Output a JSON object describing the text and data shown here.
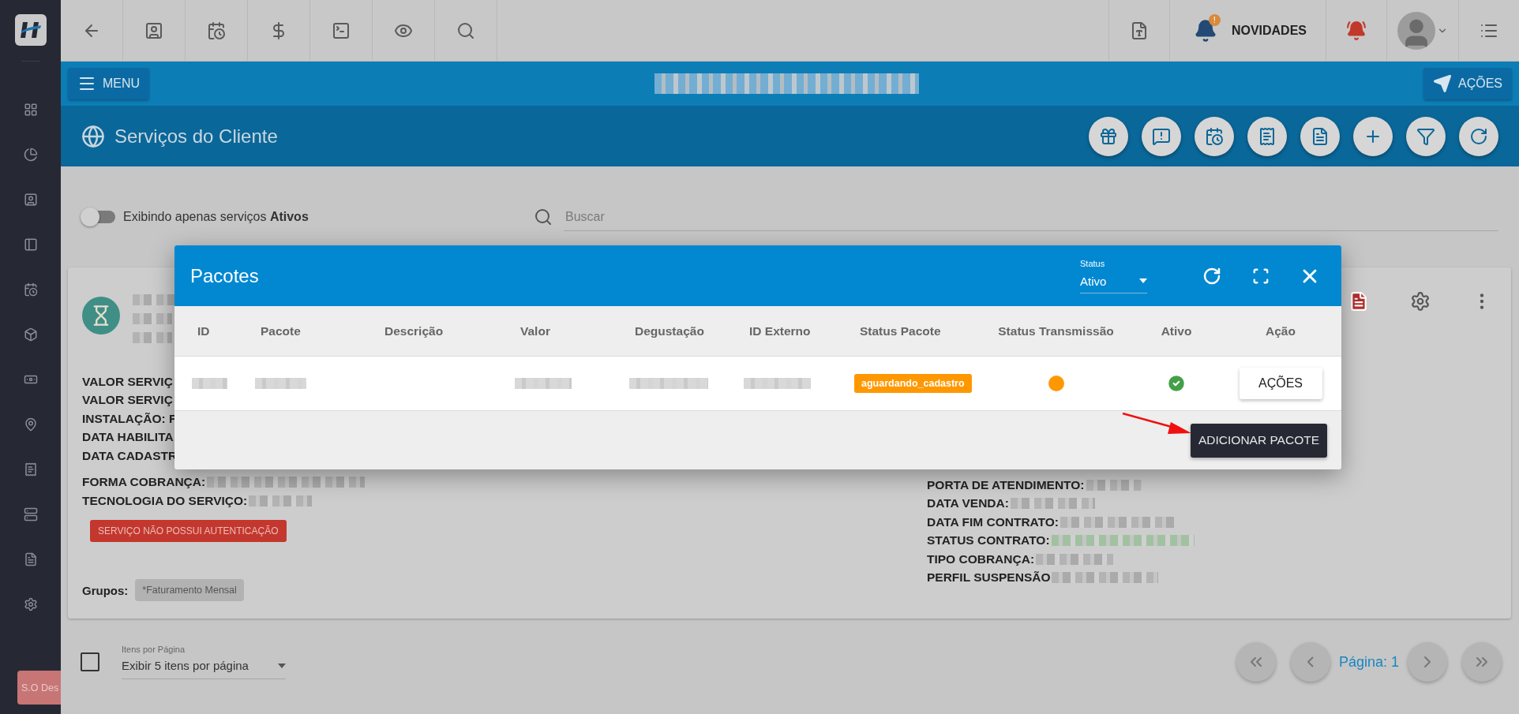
{
  "sidebar": {
    "bottom_button": "S.O Des"
  },
  "toolbar": {
    "news": "NOVIDADES",
    "news_badge": "!"
  },
  "header": {
    "menu": "MENU",
    "actions": "AÇÕES"
  },
  "title_bar": {
    "title": "Serviços do Cliente"
  },
  "filter": {
    "toggle_on": false,
    "toggle_label": "Exibindo apenas serviços **Ativos**",
    "search_placeholder": "Buscar"
  },
  "card": {
    "left_fields": [
      "VALOR SERVIÇ",
      "VALOR SERVIÇ",
      "INSTALAÇÃO: F",
      "DATA HABILITA",
      "DATA CADASTR",
      "FORMA COBRANÇA:",
      "TECNOLOGIA DO SERVIÇO:"
    ],
    "auth_badge": "SERVIÇO NÃO POSSUI AUTENTICAÇÃO",
    "groups_label": "Grupos:",
    "groups": [
      "*Faturamento Mensal"
    ],
    "right_fields": [
      "PORTA DE ATENDIMENTO:",
      "DATA VENDA:",
      "DATA FIM CONTRATO:",
      "STATUS CONTRATO:",
      "TIPO COBRANÇA:",
      "PERFIL SUSPENSÃO"
    ]
  },
  "pagination": {
    "per_page_label": "Itens por Página",
    "per_page_value": "Exibir 5 itens por página",
    "select_all": false,
    "page": "Página: 1"
  },
  "modal": {
    "title": "Pacotes",
    "status_label": "Status",
    "status_value": "Ativo",
    "columns": [
      "ID",
      "Pacote",
      "Descrição",
      "Valor",
      "Degustação",
      "ID Externo",
      "Status Pacote",
      "Status Transmissão",
      "Ativo",
      "Ação"
    ],
    "rows": [
      {
        "status": "aguardando_cadastro",
        "active": true,
        "action": "AÇÕES"
      }
    ],
    "add_button": "ADICIONAR PACOTE"
  }
}
